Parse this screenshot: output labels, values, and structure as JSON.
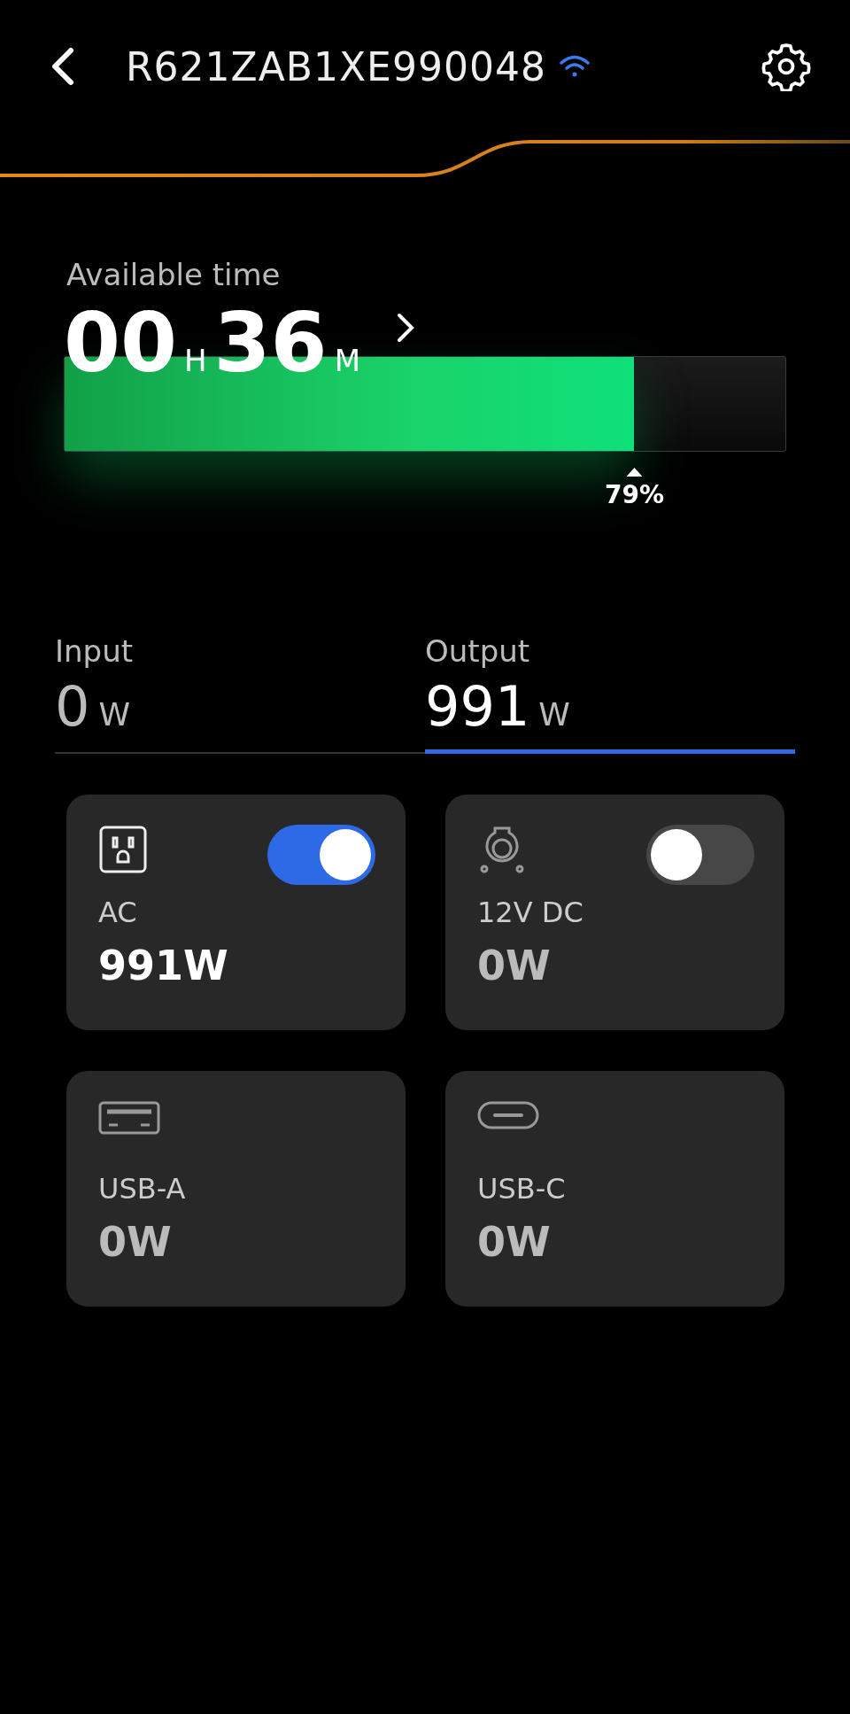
{
  "header": {
    "title": "R621ZAB1XE990048",
    "connected": true
  },
  "battery": {
    "label": "Available time",
    "hours": "00",
    "hours_unit": "H",
    "minutes": "36",
    "minutes_unit": "M",
    "level": 0.79,
    "reading": "79%"
  },
  "tabs": [
    {
      "label": "Input",
      "value": "0",
      "unit": "W",
      "selected": false
    },
    {
      "label": "Output",
      "value": "991",
      "unit": "W",
      "selected": true
    }
  ],
  "ports": [
    {
      "kind": "outlet",
      "label": "AC",
      "value": "991W",
      "on": true
    },
    {
      "kind": "car-socket",
      "label": "12V DC",
      "value": "0W",
      "on": false
    },
    {
      "kind": "usb-a",
      "label": "USB-A",
      "value": "0W"
    },
    {
      "kind": "usb-c",
      "label": "USB-C",
      "value": "0W"
    }
  ]
}
